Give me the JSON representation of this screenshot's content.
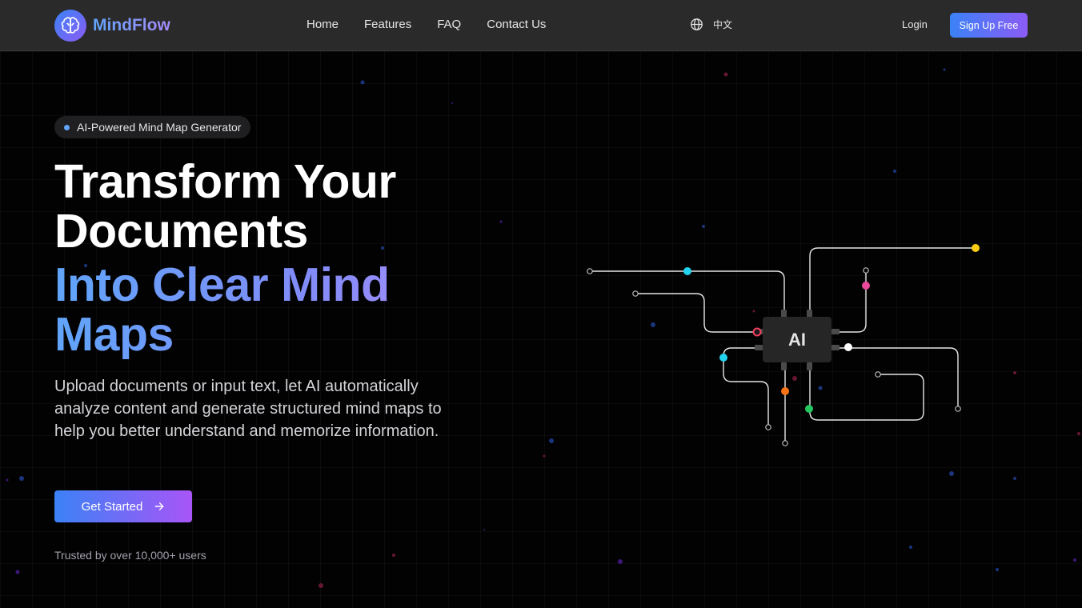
{
  "header": {
    "brand": "MindFlow",
    "nav": [
      {
        "label": "Home"
      },
      {
        "label": "Features"
      },
      {
        "label": "FAQ"
      },
      {
        "label": "Contact Us"
      }
    ],
    "language": "中文",
    "login_label": "Login",
    "signup_label": "Sign Up Free"
  },
  "hero": {
    "badge": "AI-Powered Mind Map Generator",
    "title_line1": "Transform Your Documents",
    "title_accent": "Into Clear Mind Maps",
    "description": "Upload documents or input text, let AI automatically analyze content and generate structured mind maps to help you better understand and memorize information.",
    "cta_label": "Get Started",
    "trust_text": "Trusted by over 10,000+ users"
  },
  "illustration": {
    "chip_label": "AI",
    "node_colors": [
      "#22d3ee",
      "#facc15",
      "#ec4899",
      "#f43f5e",
      "#ffffff",
      "#22d3ee",
      "#f97316",
      "#22c55e"
    ]
  },
  "colors": {
    "accent_start": "#3b82f6",
    "accent_end": "#8b5cf6",
    "nav_bg": "#2a2a2a",
    "page_bg": "#020203"
  }
}
